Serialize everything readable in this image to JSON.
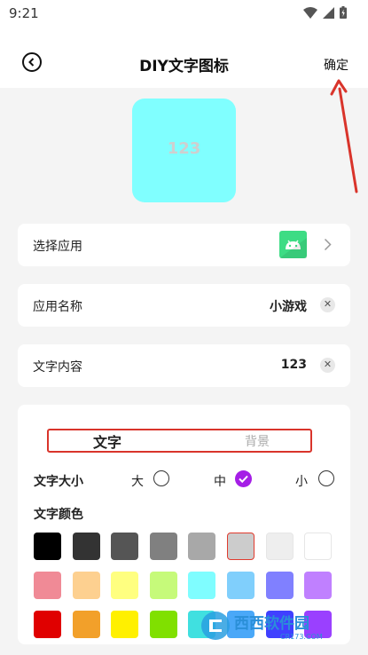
{
  "status": {
    "time": "9:21"
  },
  "header": {
    "title": "DIY文字图标",
    "confirm_label": "确定"
  },
  "preview": {
    "text": "123",
    "background": "#80ffff",
    "text_color": "#cfcfcf"
  },
  "fields": {
    "select_app_label": "选择应用",
    "app_name_label": "应用名称",
    "app_name_value": "小游戏",
    "text_content_label": "文字内容",
    "text_content_value": "123"
  },
  "tabs": {
    "text_tab": "文字",
    "background_tab": "背景",
    "active": "text_tab"
  },
  "text_size": {
    "label": "文字大小",
    "options": [
      "大",
      "中",
      "小"
    ],
    "selected": "中"
  },
  "text_color": {
    "label": "文字颜色",
    "selected": "#cccccc",
    "rows": [
      [
        "#000000",
        "#333333",
        "#555555",
        "#808080",
        "#a8a8a8",
        "#cccccc",
        "#eeeeee",
        "#ffffff"
      ],
      [
        "#f08a96",
        "#fdd090",
        "#ffff80",
        "#c6fa7a",
        "#7ffdff",
        "#80cffc",
        "#8080ff",
        "#c080ff"
      ],
      [
        "#e00000",
        "#f2a02a",
        "#fff000",
        "#80e000",
        "#40e0e0",
        "#4aa8f8",
        "#4040ff",
        "#9a40ff"
      ]
    ]
  },
  "colors": {
    "accent": "#a51ee6",
    "annotation_red": "#d9342b",
    "android_green": "#3ddc84"
  },
  "watermark": {
    "text": "西西软件园",
    "sub": "CR173.COM"
  }
}
